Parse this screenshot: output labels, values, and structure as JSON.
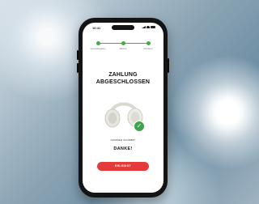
{
  "status_bar": {
    "time": "10:41"
  },
  "stepper": {
    "steps": [
      {
        "label": "Versandangaben",
        "done": true
      },
      {
        "label": "Zahlung",
        "done": true
      },
      {
        "label": "Abschluss",
        "done": true
      }
    ],
    "accent": "#3fae3f"
  },
  "confirmation": {
    "title_line1": "ZAHLUNG",
    "title_line2": "ABGESCHLOSSEN",
    "order_text": "NUMMER 62198887",
    "thanks": "DANKE!"
  },
  "button": {
    "label": "ERLEDIGT",
    "color": "#e43a3a"
  },
  "icons": [
    "headphones-image",
    "check-icon",
    "signal-icon",
    "wifi-icon",
    "battery-icon"
  ]
}
